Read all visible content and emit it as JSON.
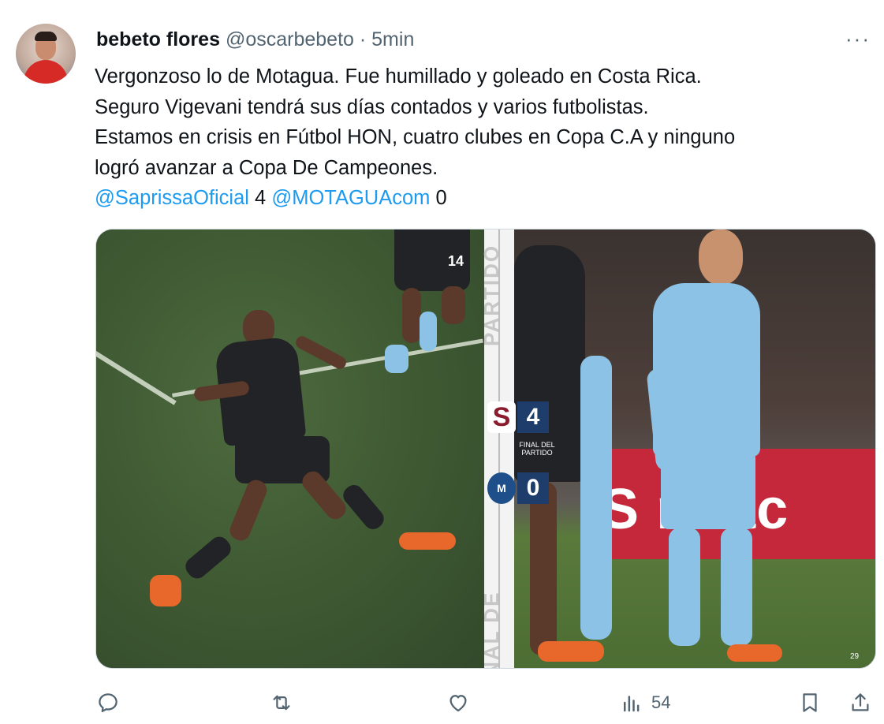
{
  "author": {
    "name": "bebeto flores",
    "handle": "@oscarbebeto",
    "separator": "·",
    "time": "5min"
  },
  "more_label": "···",
  "text": {
    "line1": "Vergonzoso lo de Motagua. Fue humillado y goleado en Costa Rica.",
    "line2": "Seguro Vigevani tendrá sus días contados y varios futbolistas.",
    "line3": "Estamos en crisis en Fútbol HON, cuatro clubes en Copa C.A y ninguno",
    "line4": "logró avanzar a Copa De Campeones.",
    "mention1": "@SaprissaOficial",
    "score1": " 4 ",
    "mention2": "@MOTAGUAcom",
    "score2": " 0"
  },
  "media": {
    "scoreboard": {
      "team1_logo": "S",
      "team1_score": "4",
      "team2_logo": "M",
      "team2_score": "0",
      "final_label": "FINAL DEL PARTIDO"
    },
    "vertical_text_top": "PARTIDO",
    "vertical_text_bottom": "FINAL DE",
    "banner_text": "S ncac",
    "photo_number": "29",
    "jersey_number": "14"
  },
  "actions": {
    "reply_icon": "reply-icon",
    "retweet_icon": "retweet-icon",
    "like_icon": "heart-icon",
    "views_icon": "views-icon",
    "views_count": "54",
    "bookmark_icon": "bookmark-icon",
    "share_icon": "share-icon"
  },
  "colors": {
    "link": "#1d9bf0",
    "secondary_text": "#536471",
    "primary_text": "#0f1419"
  }
}
